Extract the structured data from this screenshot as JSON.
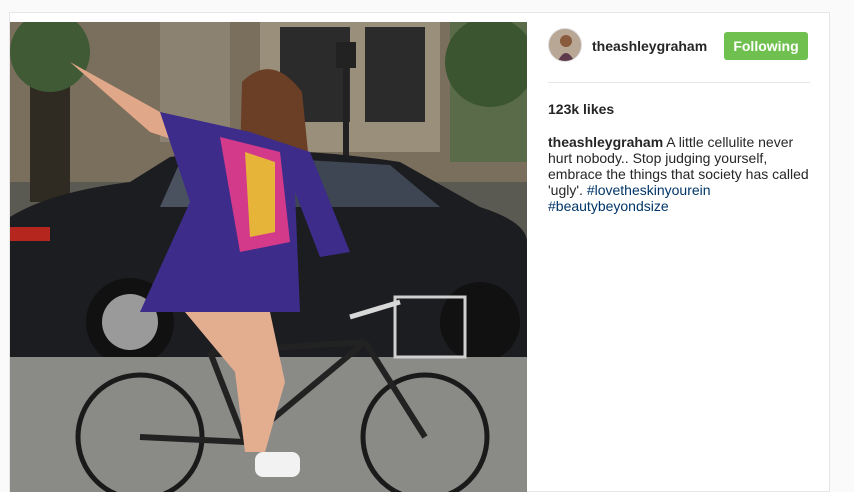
{
  "post": {
    "username": "theashleygraham",
    "follow_label": "Following",
    "likes": "123k likes",
    "caption_user": "theashleygraham",
    "caption_text": "A little cellulite never hurt nobody.. Stop judging yourself, embrace the things that society has called 'ugly'.",
    "hashtags": [
      "#lovetheskinyourein",
      "#beautybeyondsize"
    ]
  },
  "colors": {
    "follow_button": "#70c050",
    "hashtag": "#003569",
    "text": "#262626"
  }
}
